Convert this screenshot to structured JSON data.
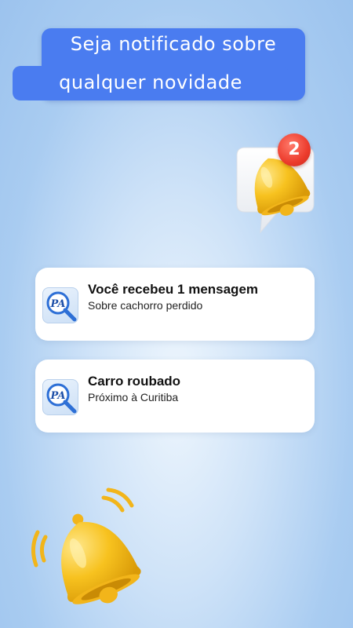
{
  "header": {
    "title_line1": "Seja notificado sobre",
    "title_line2": "qualquer novidade"
  },
  "bell_badge": {
    "count": "2",
    "color": "#ec3b2c"
  },
  "notifications": [
    {
      "title": "Você recebeu 1 mensagem",
      "subtitle": "Sobre cachorro perdido",
      "icon": "app-logo-pa-magnifier-icon"
    },
    {
      "title": "Carro roubado",
      "subtitle": "Próximo à Curitiba",
      "icon": "app-logo-pa-magnifier-icon"
    }
  ],
  "colors": {
    "banner": "#4a7cf0",
    "bell": "#f7c21f",
    "background": "#a9ccf1"
  },
  "icons": {
    "top": "notification-bell-icon",
    "bottom": "ringing-bell-icon"
  }
}
